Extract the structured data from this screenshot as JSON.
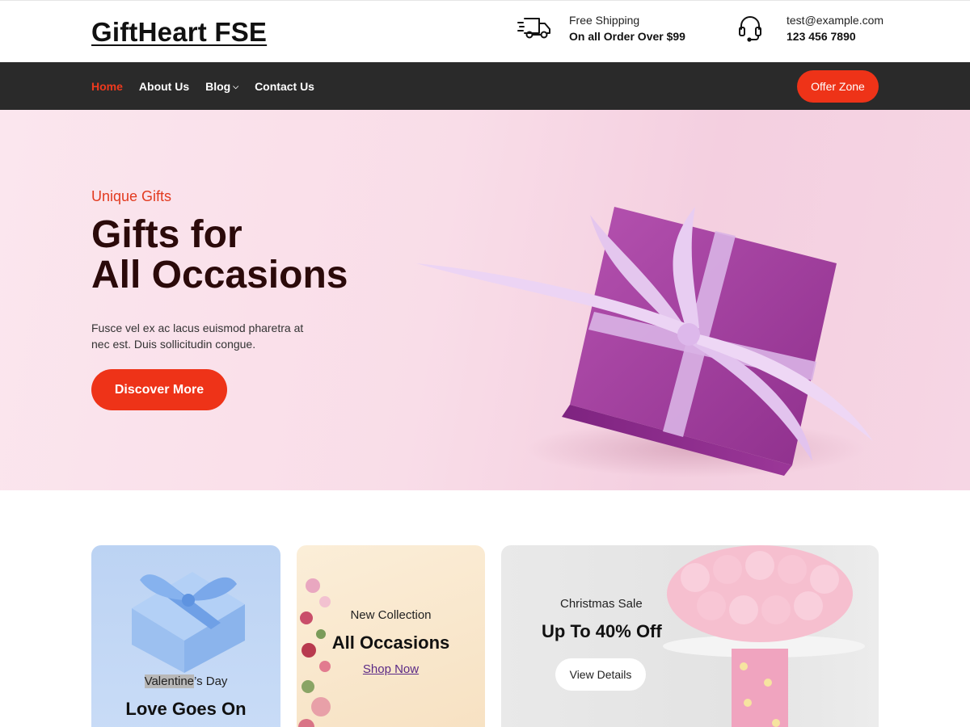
{
  "site": {
    "logo": "GiftHeart FSE"
  },
  "header_info": {
    "shipping": {
      "icon": "delivery-truck-icon",
      "line1": "Free Shipping",
      "line2": "On all Order Over $99"
    },
    "contact": {
      "icon": "headset-icon",
      "line1": "test@example.com",
      "line2": "123 456 7890"
    }
  },
  "nav": {
    "items": [
      {
        "label": "Home",
        "active": true
      },
      {
        "label": "About Us"
      },
      {
        "label": "Blog",
        "has_dropdown": true
      },
      {
        "label": "Contact Us"
      }
    ],
    "offer_button": "Offer Zone"
  },
  "hero": {
    "kicker": "Unique Gifts",
    "title": "Gifts for\nAll Occasions",
    "description": "Fusce vel ex ac lacus euismod pharetra at nec est. Duis sollicitudin congue.",
    "cta": "Discover More"
  },
  "cards": [
    {
      "small_highlight": "Valentine",
      "small_rest": "’s Day",
      "title": "Love Goes On"
    },
    {
      "small": "New Collection",
      "title": "All Occasions",
      "link": "Shop Now"
    },
    {
      "small": "Christmas Sale",
      "title": "Up To 40% Off",
      "button": "View Details"
    }
  ],
  "colors": {
    "accent": "#ee3318",
    "nav_bg": "#2a2a2a",
    "link_purple": "#5b2a86"
  }
}
